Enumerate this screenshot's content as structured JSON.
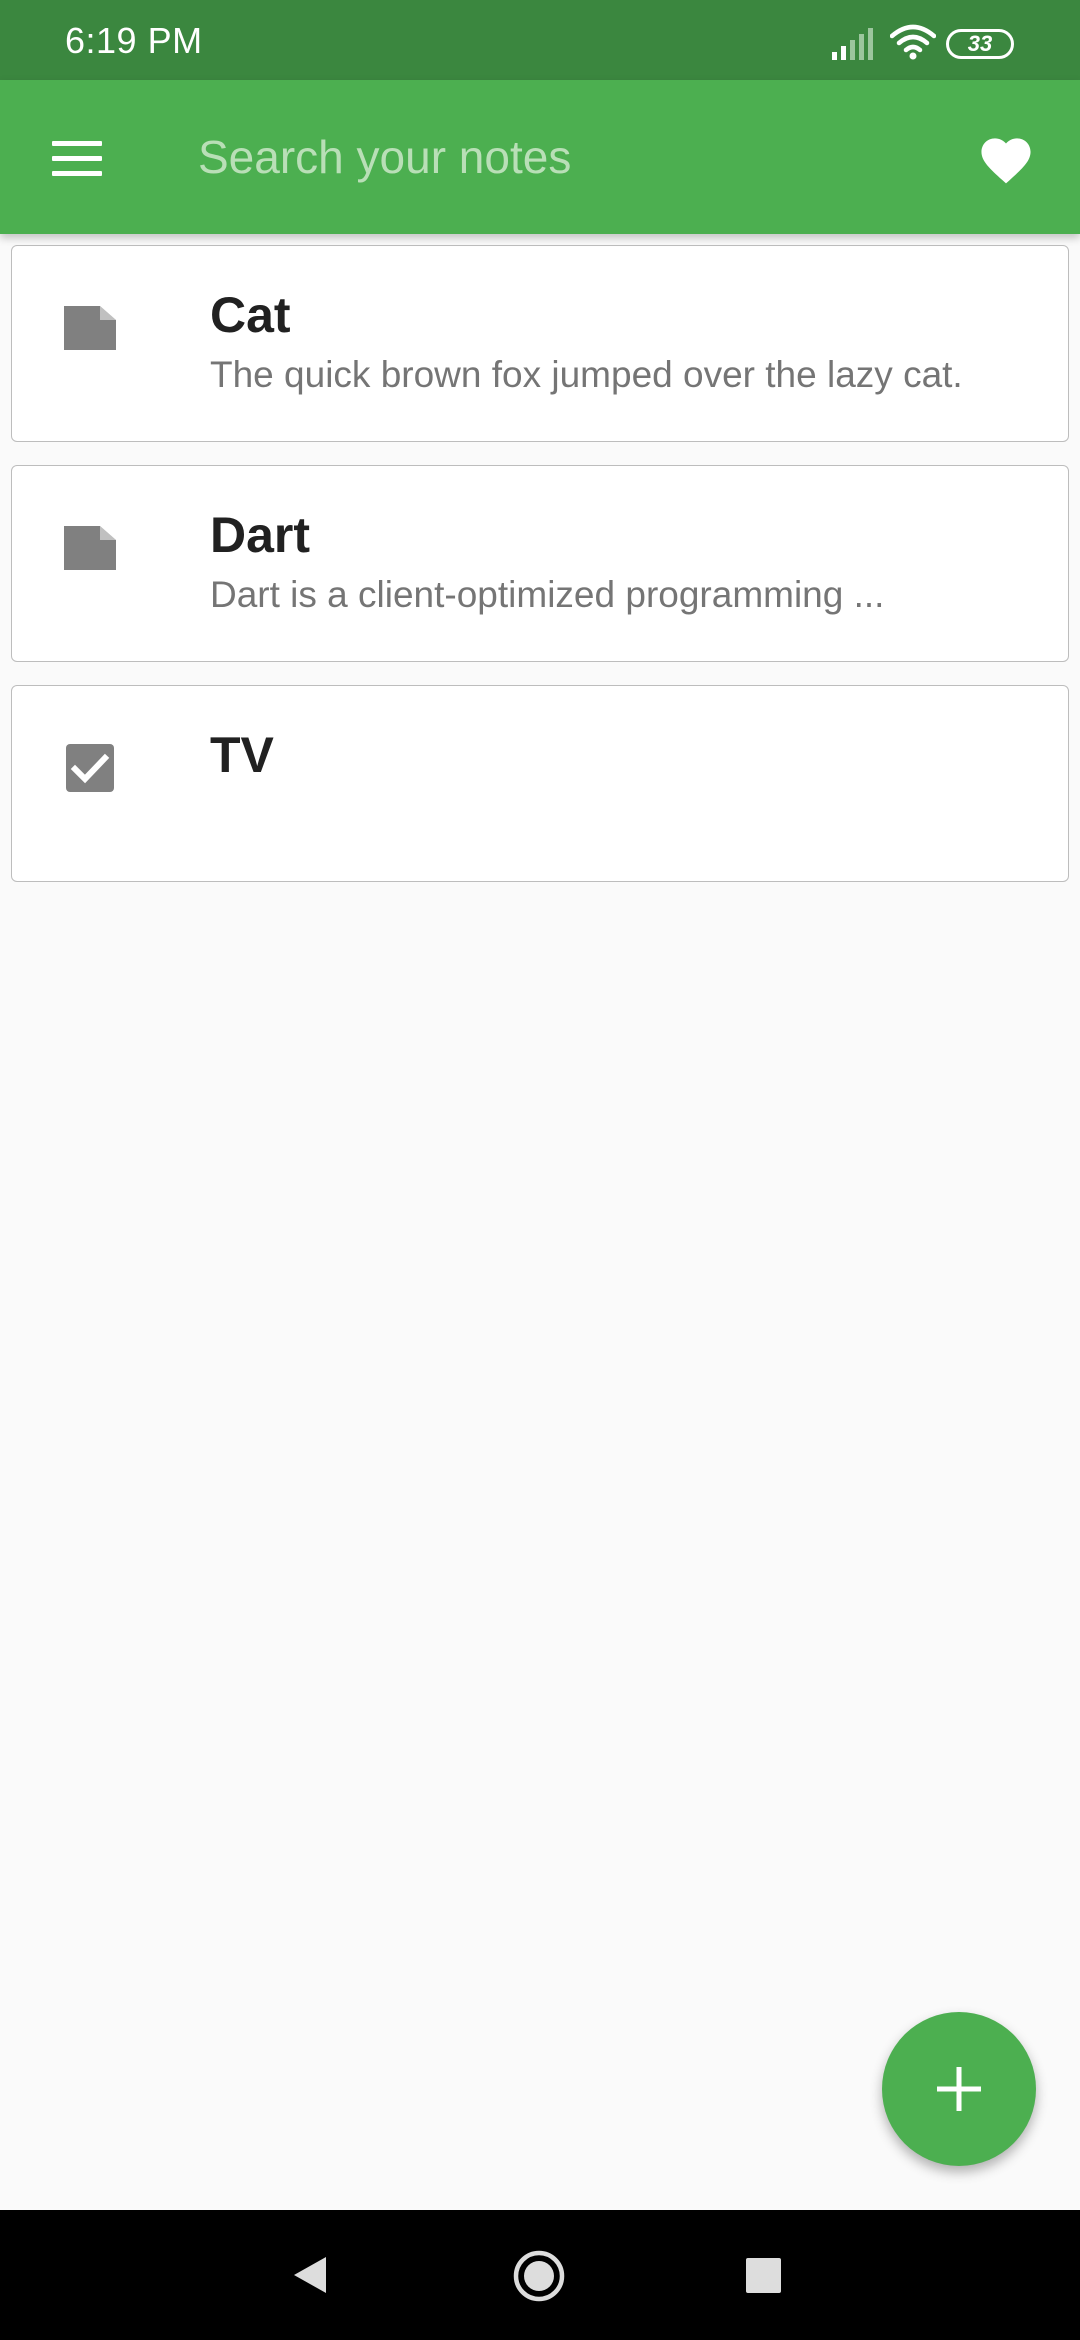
{
  "status_bar": {
    "time": "6:19 PM",
    "battery": "33",
    "icons": [
      "signal-icon",
      "wifi-icon",
      "battery-icon"
    ]
  },
  "app_bar": {
    "search_placeholder": "Search your notes",
    "menu_icon": "menu-icon",
    "favorite_icon": "heart-icon",
    "color": "#4caf50"
  },
  "notes": [
    {
      "title": "Cat",
      "preview": "The quick brown fox jumped over the lazy cat.",
      "icon": "note-icon"
    },
    {
      "title": "Dart",
      "preview": "Dart is a client-optimized programming ...",
      "icon": "note-icon"
    },
    {
      "title": "TV",
      "preview": "",
      "icon": "checkbox-icon"
    }
  ],
  "fab": {
    "icon": "add-icon"
  },
  "nav_bar": {
    "icons": [
      "back-icon",
      "home-icon",
      "recents-icon"
    ]
  }
}
